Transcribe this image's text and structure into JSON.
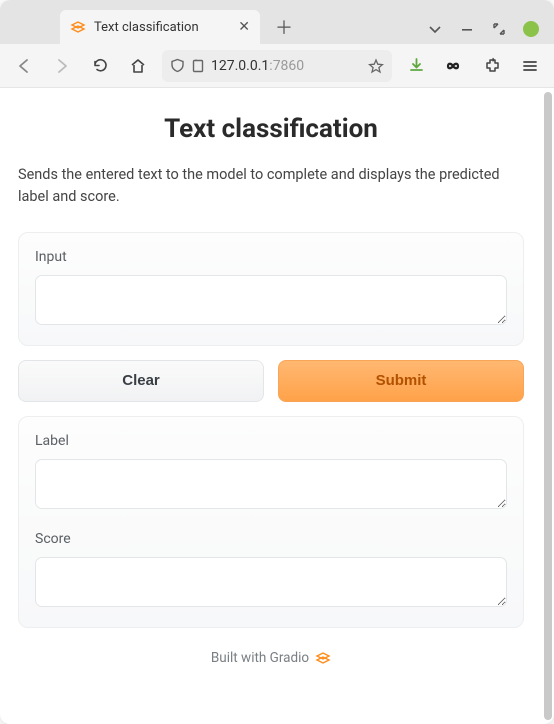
{
  "browser": {
    "tab_title": "Text classification",
    "url_host": "127.0.0.1",
    "url_port": ":7860"
  },
  "page": {
    "title": "Text classification",
    "description": "Sends the entered text to the model to complete and displays the predicted label and score.",
    "input_panel": {
      "input_label": "Input",
      "input_value": ""
    },
    "buttons": {
      "clear": "Clear",
      "submit": "Submit"
    },
    "output_panel": {
      "label_label": "Label",
      "label_value": "",
      "score_label": "Score",
      "score_value": ""
    },
    "footer": "Built with Gradio"
  },
  "colors": {
    "accent": "#ff8c1a"
  }
}
